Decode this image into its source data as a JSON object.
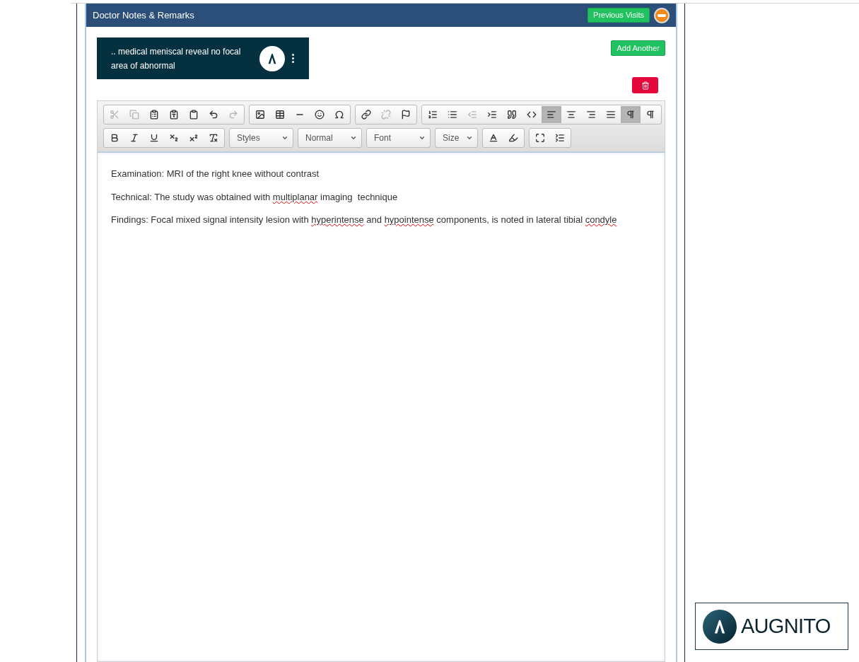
{
  "panel": {
    "title": "Doctor Notes & Remarks",
    "previous_visits": "Previous Visits",
    "collapsed": false
  },
  "dictation": {
    "text": ".. medical meniscal reveal no focal area of abnormal"
  },
  "add_another": "Add Another",
  "toolbar": {
    "rows": [
      {
        "items": [
          {
            "kind": "group",
            "buttons": [
              {
                "disabled": true,
                "selected": false
              },
              {
                "disabled": true,
                "selected": false
              },
              {
                "disabled": false,
                "selected": false
              },
              {
                "disabled": false,
                "selected": false
              },
              {
                "disabled": false,
                "selected": false
              },
              {
                "disabled": false,
                "selected": false
              },
              {
                "disabled": true,
                "selected": false
              }
            ]
          },
          {
            "kind": "group",
            "buttons": [
              {
                "disabled": false,
                "selected": false
              },
              {
                "disabled": false,
                "selected": false
              },
              {
                "disabled": false,
                "selected": false
              },
              {
                "disabled": false,
                "selected": false
              },
              {
                "disabled": false,
                "selected": false
              }
            ]
          },
          {
            "kind": "group",
            "buttons": [
              {
                "disabled": false,
                "selected": false
              },
              {
                "disabled": true,
                "selected": false
              },
              {
                "disabled": false,
                "selected": false
              }
            ]
          },
          {
            "kind": "group",
            "buttons": [
              {
                "disabled": false,
                "selected": false
              },
              {
                "disabled": false,
                "selected": false
              },
              {
                "disabled": true,
                "selected": false
              },
              {
                "disabled": false,
                "selected": false
              },
              {
                "disabled": false,
                "selected": false
              },
              {
                "disabled": false,
                "selected": false
              },
              {
                "disabled": false,
                "selected": true
              },
              {
                "disabled": false,
                "selected": false
              },
              {
                "disabled": false,
                "selected": false
              },
              {
                "disabled": false,
                "selected": false
              },
              {
                "disabled": false,
                "selected": true
              },
              {
                "disabled": false,
                "selected": false
              }
            ]
          }
        ]
      },
      {
        "items": [
          {
            "kind": "group",
            "buttons": [
              {
                "disabled": false,
                "selected": false
              },
              {
                "disabled": false,
                "selected": false
              },
              {
                "disabled": false,
                "selected": false
              },
              {
                "disabled": false,
                "selected": false
              },
              {
                "disabled": false,
                "selected": false
              },
              {
                "disabled": false,
                "selected": false
              }
            ]
          },
          {
            "kind": "dropdown",
            "label": "Styles"
          },
          {
            "kind": "dropdown",
            "label": "Normal"
          },
          {
            "kind": "dropdown",
            "label": "Font"
          },
          {
            "kind": "dropdown",
            "label": "Size"
          },
          {
            "kind": "group",
            "buttons": [
              {
                "disabled": false,
                "selected": false
              },
              {
                "disabled": false,
                "selected": false
              }
            ]
          },
          {
            "kind": "group",
            "buttons": [
              {
                "disabled": false,
                "selected": false
              },
              {
                "disabled": false,
                "selected": false
              }
            ]
          }
        ]
      }
    ]
  },
  "editor": {
    "paragraphs": [
      {
        "segments": [
          {
            "text": "Examination: MRI of the right knee without contrast",
            "misspelled": false
          }
        ]
      },
      {
        "segments": [
          {
            "text": "Technical: The study was obtained with ",
            "misspelled": false
          },
          {
            "text": "multiplanar",
            "misspelled": true
          },
          {
            "text": " imaging  technique",
            "misspelled": false
          }
        ]
      },
      {
        "segments": [
          {
            "text": "Findings: Focal mixed signal intensity lesion with ",
            "misspelled": false
          },
          {
            "text": "hyperintense",
            "misspelled": true
          },
          {
            "text": " and ",
            "misspelled": false
          },
          {
            "text": "hypointense",
            "misspelled": true
          },
          {
            "text": " components, is noted in lateral tibial ",
            "misspelled": false
          },
          {
            "text": "condyle",
            "misspelled": true
          }
        ]
      }
    ]
  },
  "logo": {
    "text": "AUGNITO"
  }
}
